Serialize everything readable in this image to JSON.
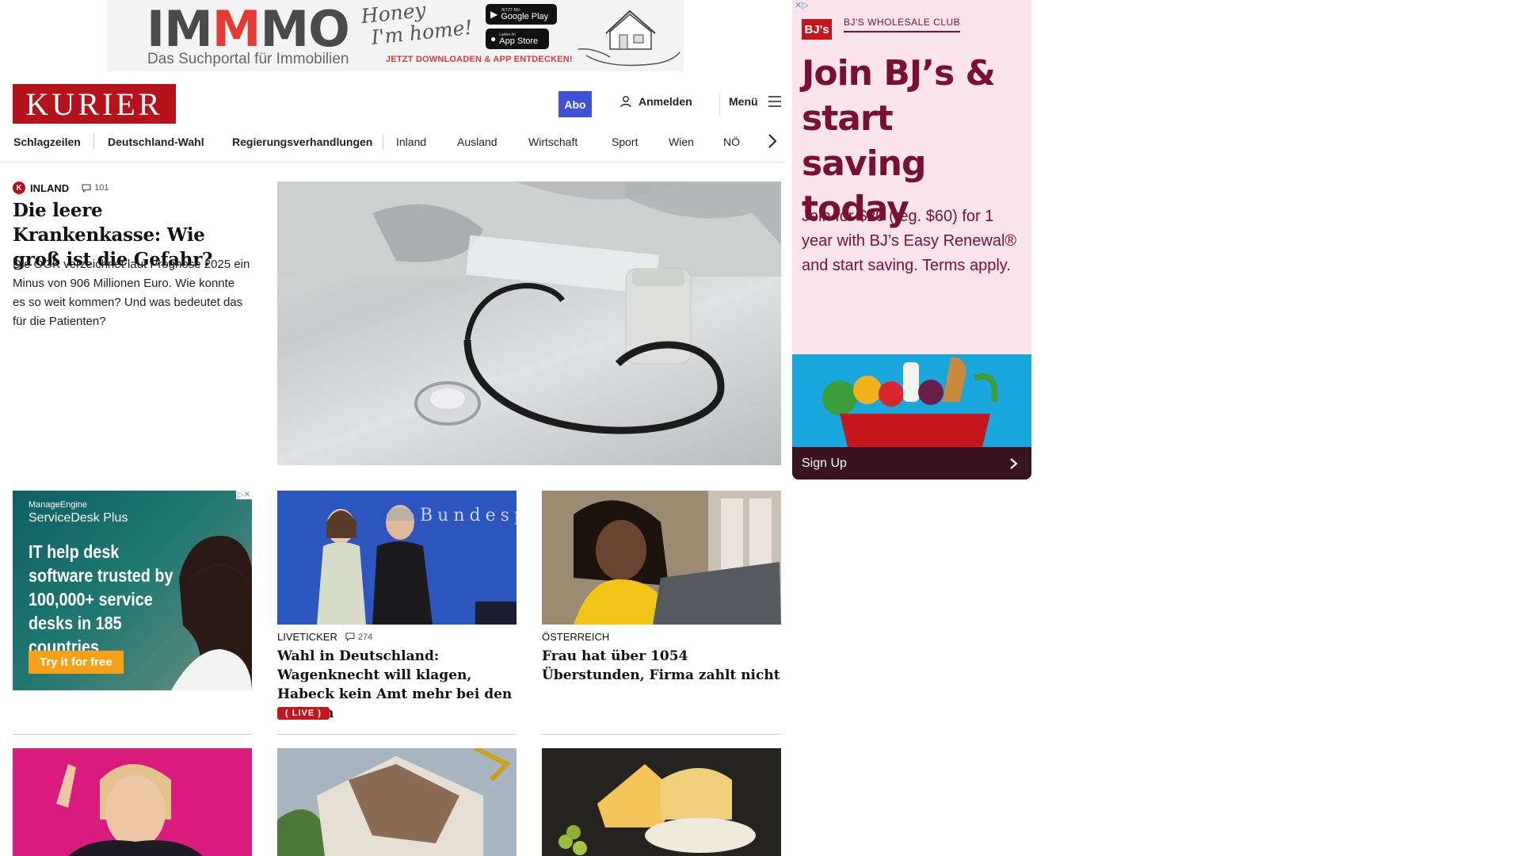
{
  "top_ad": {
    "logo_prefix": "IM",
    "logo_red": "M",
    "logo_suffix": "MO",
    "tagline": "Das Suchportal für Immobilien",
    "handwriting_line1": "Honey",
    "handwriting_line2": "I'm home!",
    "google_play_small": "JETZT BEI",
    "google_play_label": "Google Play",
    "app_store_small": "Laden im",
    "app_store_label": "App Store",
    "cta": "JETZT DOWNLOADEN & APP ENTDECKEN!"
  },
  "header": {
    "logo": "KURIER",
    "abo_label": "Abo",
    "login_label": "Anmelden",
    "menu_label": "Menü"
  },
  "nav": {
    "items": [
      "Schlagzeilen",
      "Deutschland-Wahl",
      "Regierungsverhandlungen",
      "Inland",
      "Ausland",
      "Wirtschaft",
      "Sport",
      "Wien",
      "NÖ"
    ]
  },
  "lead": {
    "category": "INLAND",
    "comments": "101",
    "title": "Die leere Krankenkasse: Wie groß ist die Gefahr?",
    "teaser": "Die ÖGK verzeichnet laut Prognose 2025 ein Minus von 906 Millionen Euro. Wie konnte es so weit kommen? Und was bedeutet das für die Patienten?"
  },
  "ad_manageengine": {
    "brand": "ManageEngine",
    "product": "ServiceDesk Plus",
    "headline": "IT help desk software trusted by 100,000+ service desks in 185 countries",
    "cta": "Try it for free"
  },
  "cards": [
    {
      "label": "LIVETICKER",
      "comments": "274",
      "title": "Wahl in Deutschland: Wagenknecht will klagen, Habeck kein Amt mehr bei den Grünen",
      "badge": "LIVE",
      "image_text": "Bundesp"
    },
    {
      "label": "ÖSTERREICH",
      "title": "Frau hat über 1054 Überstunden, Firma zahlt nicht"
    }
  ],
  "ad_bjs": {
    "logo": "BJ's",
    "club": "BJ'S WHOLESALE CLUB",
    "headline": "Join BJ’s & start saving today",
    "body": "Join for $20 (reg. $60) for 1 year with BJ’s Easy Renewal® and start saving. Terms apply.",
    "cta": "Sign Up"
  },
  "colors": {
    "kurier_red": "#b5121b",
    "abo_blue": "#3f51d9",
    "bjs_maroon": "#7a1030",
    "bjs_pink": "#fce4ec",
    "live_red": "#c4161c"
  }
}
